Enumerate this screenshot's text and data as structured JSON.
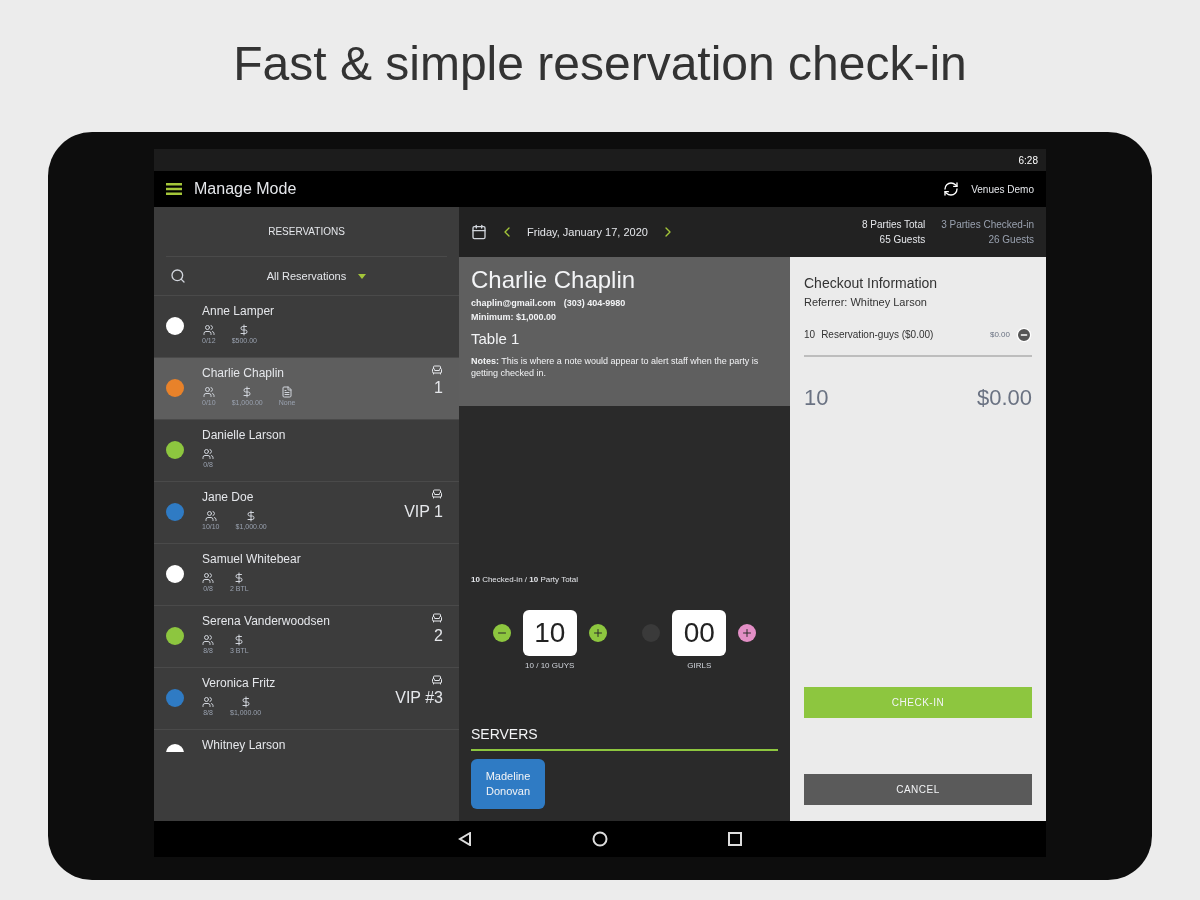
{
  "headline": "Fast & simple reservation check-in",
  "status_bar": {
    "time": "6:28"
  },
  "app_bar": {
    "title": "Manage Mode",
    "venue": "Venues Demo"
  },
  "sidebar": {
    "title": "RESERVATIONS",
    "filter": "All Reservations",
    "items": [
      {
        "name": "Anne Lamper",
        "color": "#ffffff",
        "selected": false,
        "stats": [
          {
            "kind": "guests",
            "text": "0/12"
          },
          {
            "kind": "min",
            "text": "$500.00"
          }
        ]
      },
      {
        "name": "Charlie Chaplin",
        "color": "#e8822a",
        "selected": true,
        "table": "1",
        "stats": [
          {
            "kind": "guests",
            "text": "0/10"
          },
          {
            "kind": "min",
            "text": "$1,000.00"
          },
          {
            "kind": "notes",
            "text": "None"
          }
        ]
      },
      {
        "name": "Danielle Larson",
        "color": "#8dc63f",
        "selected": false,
        "stats": [
          {
            "kind": "guests",
            "text": "0/8"
          }
        ]
      },
      {
        "name": "Jane Doe",
        "color": "#2f7bc4",
        "selected": false,
        "table": "VIP 1",
        "stats": [
          {
            "kind": "guests",
            "text": "10/10"
          },
          {
            "kind": "min",
            "text": "$1,000.00"
          }
        ]
      },
      {
        "name": "Samuel Whitebear",
        "color": "#ffffff",
        "selected": false,
        "stats": [
          {
            "kind": "guests",
            "text": "0/8"
          },
          {
            "kind": "min",
            "text": "2 BTL"
          }
        ]
      },
      {
        "name": "Serena Vanderwoodsen",
        "color": "#8dc63f",
        "selected": false,
        "table": "2",
        "stats": [
          {
            "kind": "guests",
            "text": "8/8"
          },
          {
            "kind": "min",
            "text": "3 BTL"
          }
        ]
      },
      {
        "name": "Veronica Fritz",
        "color": "#2f7bc4",
        "selected": false,
        "table": "VIP #3",
        "stats": [
          {
            "kind": "guests",
            "text": "8/8"
          },
          {
            "kind": "min",
            "text": "$1,000.00"
          }
        ]
      },
      {
        "name": "Whitney Larson",
        "color": "#ffffff",
        "selected": false
      }
    ]
  },
  "date_nav": {
    "date": "Friday, January 17, 2020"
  },
  "totals": [
    {
      "parties": "8 Parties Total",
      "guests": "65 Guests",
      "dim": false
    },
    {
      "parties": "3 Parties Checked-in",
      "guests": "26 Guests",
      "dim": true
    }
  ],
  "detail": {
    "name": "Charlie Chaplin",
    "email": "chaplin@gmail.com",
    "phone": "(303) 404-9980",
    "minimum": "Minimum: $1,000.00",
    "table": "Table 1",
    "notes": "**Notes:** This is where a note would appear to alert staff when the party is getting checked in."
  },
  "checked_in": "**10** Checked-in / **10** Party Total",
  "counters": [
    {
      "value": "10",
      "label": "10 / 10 GUYS",
      "minus_disabled": false,
      "color": "#8dc63f"
    },
    {
      "value": "00",
      "label": "GIRLS",
      "minus_disabled": true,
      "color": "#e38fc6"
    }
  ],
  "servers": {
    "title": "SERVERS",
    "names": [
      "Madeline Donovan"
    ]
  },
  "checkout": {
    "title": "Checkout Information",
    "referrer": "Referrer: Whitney Larson",
    "lines": [
      {
        "qty": "10",
        "desc": "Reservation-guys ($0.00)",
        "price": "$0.00"
      }
    ],
    "total_qty": "10",
    "total": "$0.00",
    "buttons": [
      {
        "kind": "primary",
        "label": "CHECK-IN"
      },
      {
        "kind": "secondary",
        "label": "CANCEL"
      }
    ]
  }
}
